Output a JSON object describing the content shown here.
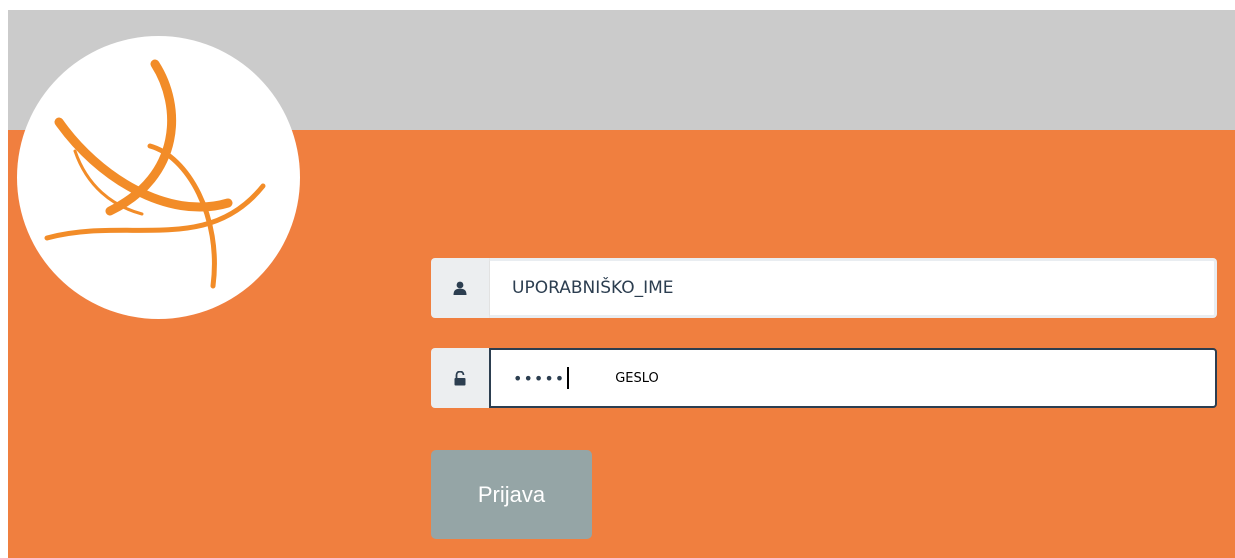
{
  "logo": {
    "icon": "orange-crossed-arcs-logo",
    "color": "#f28c28",
    "background": "#ffffff"
  },
  "colors": {
    "top_band": "#cbcbcb",
    "main_background": "#f07f3f",
    "button_background": "#95a5a6",
    "input_text": "#2c3e50"
  },
  "login_form": {
    "username": {
      "icon": "user-icon",
      "placeholder": "UPORABNIŠKO_IME",
      "value": ""
    },
    "password": {
      "icon": "unlock-icon",
      "masked_value": "•••••",
      "label": "GESLO"
    },
    "submit_label": "Prijava"
  }
}
